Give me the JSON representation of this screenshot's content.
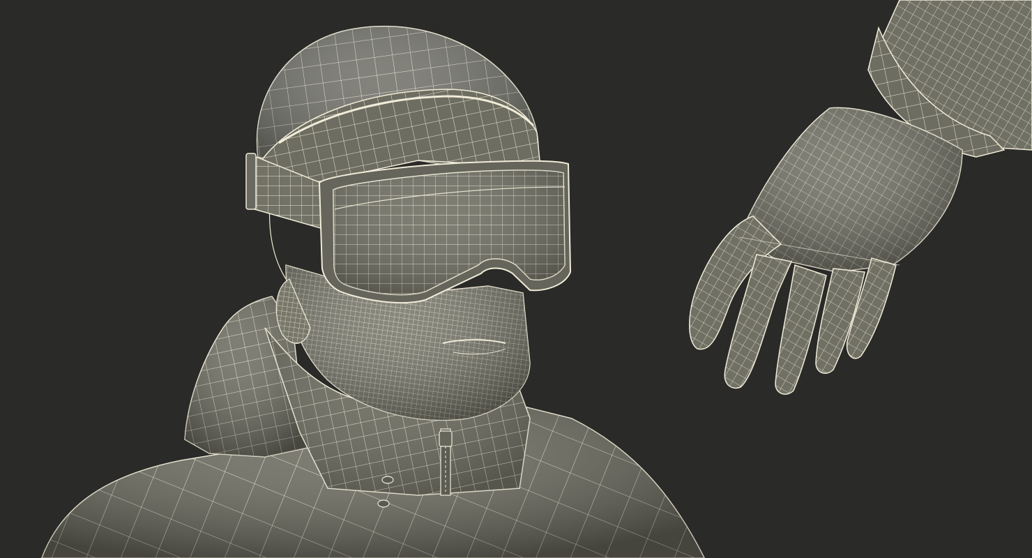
{
  "scene": {
    "subject": "wireframe-skier",
    "colors": {
      "background": "#2a2a28",
      "surface": "#6f6f63",
      "surface_light": "#8a8a7c",
      "surface_dark": "#55554b",
      "wire": "#f1ecd9"
    },
    "objects": [
      {
        "name": "beanie-hat"
      },
      {
        "name": "ski-goggles"
      },
      {
        "name": "face"
      },
      {
        "name": "hooded-jacket"
      },
      {
        "name": "glove"
      }
    ]
  }
}
